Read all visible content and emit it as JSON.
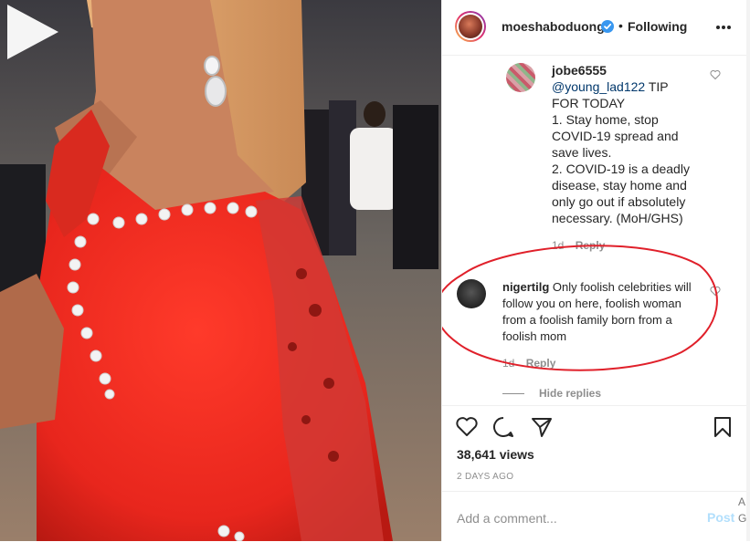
{
  "header": {
    "username": "moeshaboduong",
    "separator": "•",
    "follow_status": "Following",
    "more_icon": "more-horizontal-icon",
    "verified_color": "#3897f0"
  },
  "video": {
    "play_icon": "play-icon"
  },
  "comments": [
    {
      "username": "jobe6555",
      "mention": "@young_lad122",
      "text_after_mention": " TIP FOR TODAY",
      "lines": [
        "1. Stay home, stop COVID-19 spread and save lives.",
        "2. COVID-19 is a deadly disease, stay home and only go out if absolutely necessary. (MoH/GHS)"
      ],
      "age": "1d",
      "reply_label": "Reply"
    },
    {
      "username": "nigertilg",
      "text": "Only foolish celebrities will follow you on here, foolish woman from a foolish family born from a foolish mom",
      "age": "1d",
      "reply_label": "Reply"
    }
  ],
  "hide_replies_label": "Hide replies",
  "stats": {
    "views": "38,641 views",
    "posted": "2 DAYS AGO"
  },
  "composer": {
    "placeholder": "Add a comment...",
    "post_label": "Post"
  },
  "edge_fragment": "A\nG",
  "colors": {
    "annotation_circle": "#e0202a",
    "link_blue": "#00376b",
    "post_disabled": "#b2dffc"
  }
}
